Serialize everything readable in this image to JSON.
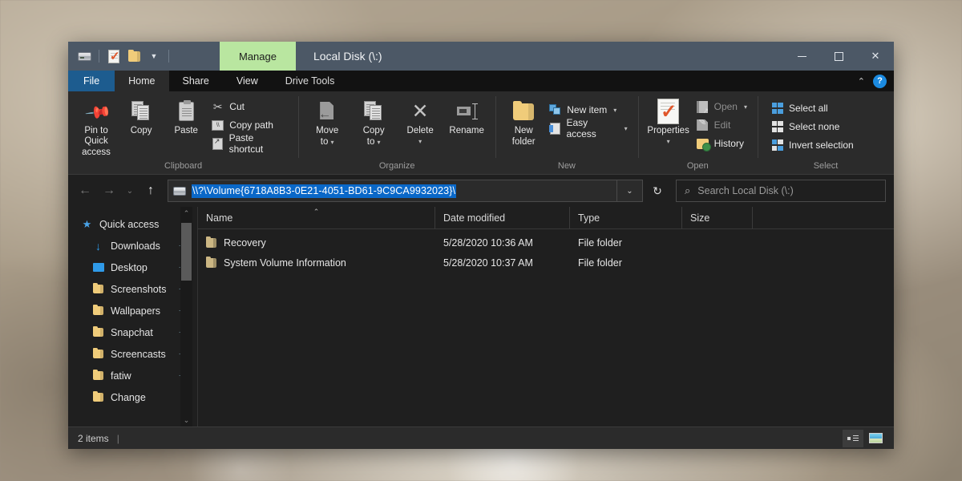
{
  "window": {
    "title": "Local Disk (\\:)",
    "contextual_tab": "Manage",
    "contextual_tab_color": "#b9e6a0",
    "quick_access_toolbar": [
      "drive-icon",
      "properties-icon",
      "new-folder-icon",
      "customize-caret"
    ],
    "controls": {
      "minimize": "—",
      "maximize": "▢",
      "close": "✕"
    }
  },
  "tabs": [
    {
      "label": "File"
    },
    {
      "label": "Home"
    },
    {
      "label": "Share"
    },
    {
      "label": "View"
    },
    {
      "label": "Drive Tools"
    }
  ],
  "tabstrip_right": {
    "collapse": "⌃",
    "help": "?"
  },
  "ribbon": {
    "groups": [
      {
        "name": "Clipboard",
        "big_buttons": [
          {
            "label_line1": "Pin to Quick",
            "label_line2": "access",
            "icon": "pin-icon"
          },
          {
            "label_line1": "Copy",
            "label_line2": "",
            "icon": "copy-icon"
          },
          {
            "label_line1": "Paste",
            "label_line2": "",
            "icon": "paste-icon"
          }
        ],
        "small_buttons": [
          {
            "label": "Cut",
            "icon": "scissors-icon",
            "caret": ""
          },
          {
            "label": "Copy path",
            "icon": "copy-path-icon",
            "caret": ""
          },
          {
            "label": "Paste shortcut",
            "icon": "paste-shortcut-icon",
            "caret": ""
          }
        ]
      },
      {
        "name": "Organize",
        "big_buttons": [
          {
            "label_line1": "Move",
            "label_line2": "to",
            "icon": "move-to-icon",
            "caret": "▾"
          },
          {
            "label_line1": "Copy",
            "label_line2": "to",
            "icon": "copy-to-icon",
            "caret": "▾"
          },
          {
            "label_line1": "Delete",
            "label_line2": "",
            "icon": "delete-icon",
            "caret": "▾"
          },
          {
            "label_line1": "Rename",
            "label_line2": "",
            "icon": "rename-icon"
          }
        ],
        "small_buttons": []
      },
      {
        "name": "New",
        "big_buttons": [
          {
            "label_line1": "New",
            "label_line2": "folder",
            "icon": "new-folder-icon"
          }
        ],
        "small_buttons": [
          {
            "label": "New item",
            "icon": "new-item-icon",
            "caret": "▾"
          },
          {
            "label": "Easy access",
            "icon": "easy-access-icon",
            "caret": "▾"
          }
        ]
      },
      {
        "name": "Open",
        "big_buttons": [
          {
            "label_line1": "Properties",
            "label_line2": "",
            "icon": "properties-icon",
            "caret": "▾"
          }
        ],
        "small_buttons": [
          {
            "label": "Open",
            "icon": "open-icon",
            "caret": "▾",
            "dim": true
          },
          {
            "label": "Edit",
            "icon": "edit-icon",
            "caret": "",
            "dim": true
          },
          {
            "label": "History",
            "icon": "history-icon",
            "caret": ""
          }
        ]
      },
      {
        "name": "Select",
        "big_buttons": [],
        "small_buttons": [
          {
            "label": "Select all",
            "icon": "select-all-icon",
            "caret": ""
          },
          {
            "label": "Select none",
            "icon": "select-none-icon",
            "caret": ""
          },
          {
            "label": "Invert selection",
            "icon": "invert-selection-icon",
            "caret": ""
          }
        ]
      }
    ]
  },
  "address_bar": {
    "back": "←",
    "forward": "→",
    "recent": "⌄",
    "up": "↑",
    "path": "\\\\?\\Volume{6718A8B3-0E21-4051-BD61-9C9CA9932023}\\",
    "path_selected": true,
    "selection_color": "#0a68c8",
    "dropdown": "⌄",
    "refresh": "↻"
  },
  "search": {
    "placeholder": "Search Local Disk (\\:)",
    "icon": "search-icon"
  },
  "sidebar": {
    "items": [
      {
        "label": "Quick access",
        "icon": "star-icon",
        "pinned": false,
        "child": false
      },
      {
        "label": "Downloads",
        "icon": "download-icon",
        "pinned": true,
        "child": true
      },
      {
        "label": "Desktop",
        "icon": "desktop-icon",
        "pinned": true,
        "child": true
      },
      {
        "label": "Screenshots",
        "icon": "folder-icon",
        "pinned": true,
        "child": true
      },
      {
        "label": "Wallpapers",
        "icon": "folder-icon",
        "pinned": true,
        "child": true
      },
      {
        "label": "Snapchat",
        "icon": "folder-icon",
        "pinned": true,
        "child": true
      },
      {
        "label": "Screencasts",
        "icon": "folder-icon",
        "pinned": true,
        "child": true
      },
      {
        "label": "fatiw",
        "icon": "folder-icon",
        "pinned": true,
        "child": true
      },
      {
        "label": "Change",
        "icon": "folder-icon",
        "pinned": false,
        "child": true
      }
    ],
    "scroll_up": "⌃",
    "scroll_down": "⌄"
  },
  "filelist": {
    "columns": [
      {
        "key": "name",
        "label": "Name",
        "sorted": "asc",
        "sort_glyph": "⌃"
      },
      {
        "key": "date",
        "label": "Date modified"
      },
      {
        "key": "type",
        "label": "Type"
      },
      {
        "key": "size",
        "label": "Size"
      }
    ],
    "rows": [
      {
        "name": "Recovery",
        "date": "5/28/2020 10:36 AM",
        "type": "File folder",
        "size": "",
        "icon": "folder-icon"
      },
      {
        "name": "System Volume Information",
        "date": "5/28/2020 10:37 AM",
        "type": "File folder",
        "size": "",
        "icon": "folder-icon"
      }
    ]
  },
  "statusbar": {
    "item_count": "2 items",
    "separator": "|",
    "views": [
      {
        "name": "details-view",
        "active": true
      },
      {
        "name": "large-icons-view",
        "active": false
      }
    ]
  }
}
